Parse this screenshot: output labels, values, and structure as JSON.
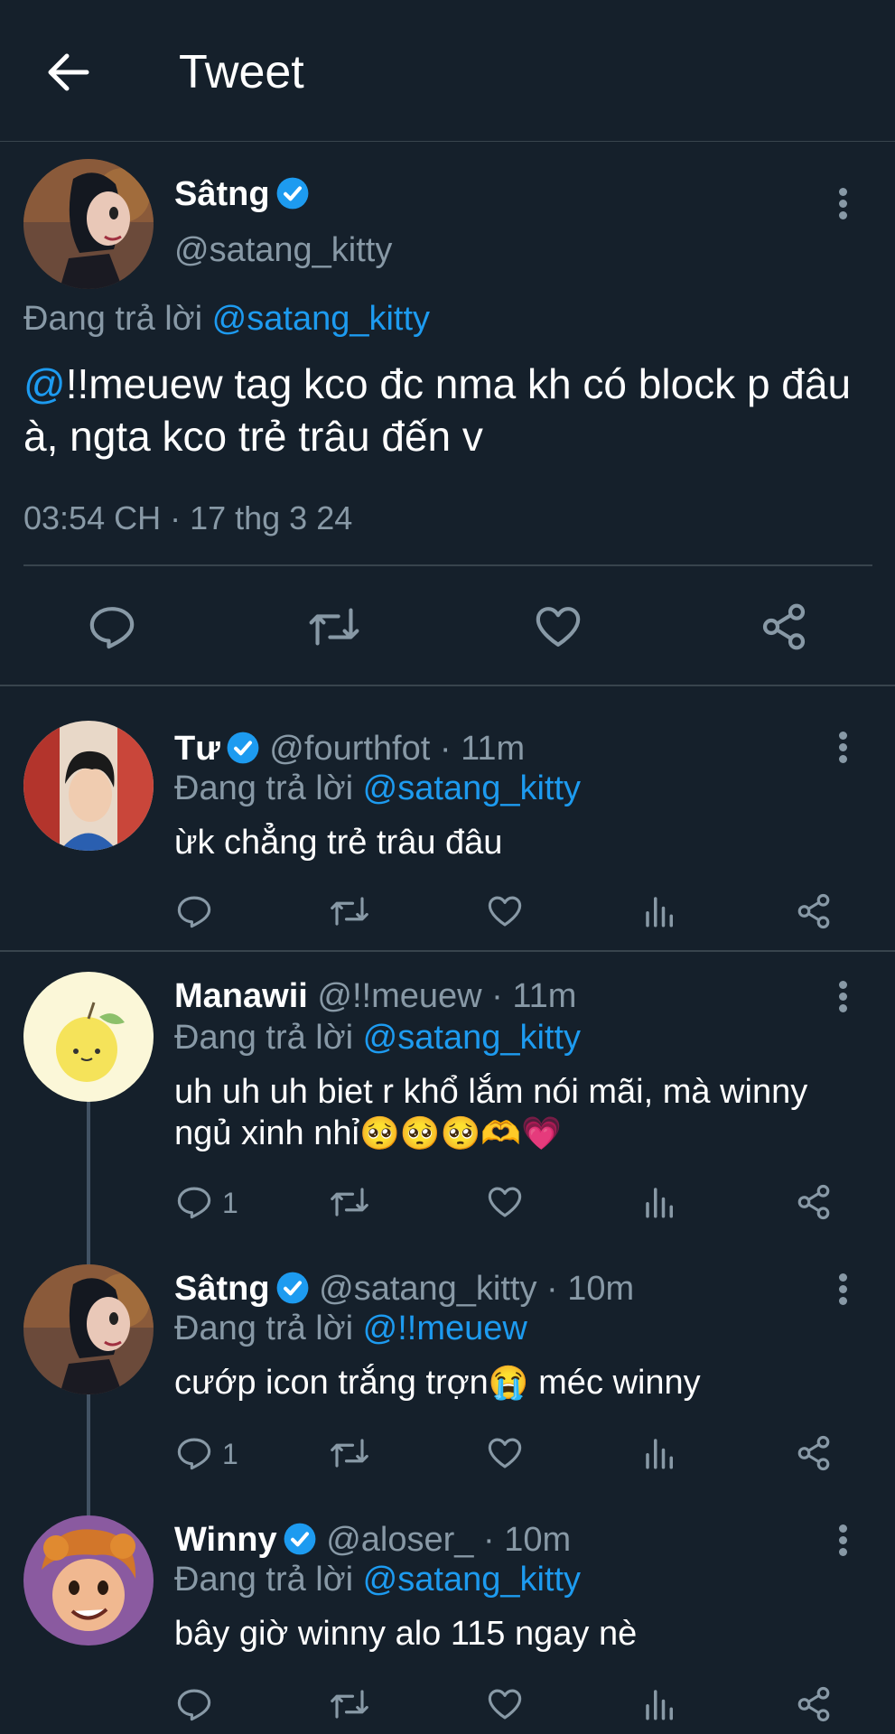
{
  "header": {
    "title": "Tweet"
  },
  "main_tweet": {
    "name": "Sâtng",
    "handle": "@satang_kitty",
    "replying_to_prefix": "Đang trả lời",
    "replying_to_handle": "@satang_kitty",
    "text_mention": "@",
    "text": "!!meuew tag kco đc nma kh có block p đâu à, ngta kco trẻ trâu đến v",
    "timestamp": "03:54 CH · 17 thg 3 24"
  },
  "replies": [
    {
      "name": "Tư",
      "handle": "@fourthfot",
      "time": "· 11m",
      "replying_to_prefix": "Đang trả lời",
      "replying_to_handle": "@satang_kitty",
      "text": "ừk chẳng trẻ trâu đâu",
      "reply_count": ""
    },
    {
      "name": "Manawii",
      "handle": "@!!meuew",
      "time": "· 11m",
      "replying_to_prefix": "Đang trả lời",
      "replying_to_handle": "@satang_kitty",
      "text_line1": "uh uh uh biet r khổ lắm nói mãi, mà winny",
      "text_line2": "ngủ xinh nhỉ",
      "reply_count": "1"
    },
    {
      "name": "Sâtng",
      "handle": "@satang_kitty",
      "time": "· 10m",
      "replying_to_prefix": "Đang trả lời",
      "replying_to_handle": "@!!meuew",
      "text_a": "cướp icon trắng trợn",
      "text_b": " méc winny",
      "reply_count": "1"
    },
    {
      "name": "Winny",
      "handle": "@aloser_",
      "time": "· 10m",
      "replying_to_prefix": "Đang trả lời",
      "replying_to_handle": "@satang_kitty",
      "text": "bây giờ winny alo 115 ngay nè",
      "reply_count": ""
    }
  ],
  "colors": {
    "background": "#15202b",
    "accent": "#1d9bf0",
    "secondary": "#8899a6",
    "divider": "#38444d"
  },
  "icons": [
    "back-arrow-icon",
    "verified-badge-icon",
    "more-options-icon",
    "reply-icon",
    "retweet-icon",
    "like-icon",
    "share-icon",
    "views-icon"
  ]
}
